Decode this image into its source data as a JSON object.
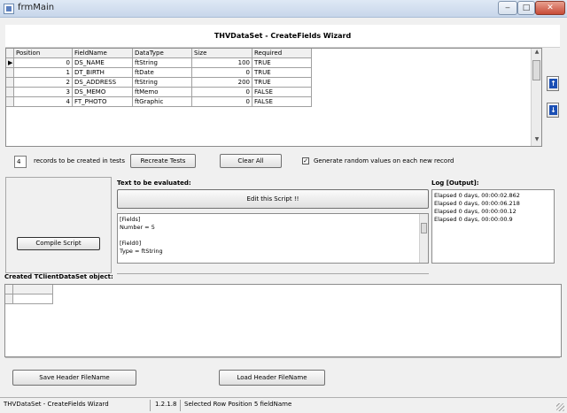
{
  "window": {
    "title": "frmMain",
    "title_ghost": "",
    "controls": {
      "minimize": "‒",
      "maximize": "□",
      "close": "✕"
    }
  },
  "wizard": {
    "title": "THVDataSet - CreateFields Wizard"
  },
  "fields_grid": {
    "columns": [
      "Position",
      "FieldName",
      "DataType",
      "Size",
      "Required"
    ],
    "rows": [
      {
        "position": "0",
        "fieldname": "DS_NAME",
        "datatype": "ftString",
        "size": "100",
        "required": "TRUE",
        "current": true
      },
      {
        "position": "1",
        "fieldname": "DT_BIRTH",
        "datatype": "ftDate",
        "size": "0",
        "required": "TRUE",
        "current": false
      },
      {
        "position": "2",
        "fieldname": "DS_ADDRESS",
        "datatype": "ftString",
        "size": "200",
        "required": "TRUE",
        "current": false
      },
      {
        "position": "3",
        "fieldname": "DS_MEMO",
        "datatype": "ftMemo",
        "size": "0",
        "required": "FALSE",
        "current": false
      },
      {
        "position": "4",
        "fieldname": "FT_PHOTO",
        "datatype": "ftGraphic",
        "size": "0",
        "required": "FALSE",
        "current": false
      }
    ],
    "current_row_marker": "▶"
  },
  "options": {
    "records_value": "4",
    "records_label": "records to be created in tests",
    "recreate_tests_label": "Recreate Tests",
    "clear_all_label": "Clear All",
    "random_checked": true,
    "random_label": "Generate random values on each new record"
  },
  "script": {
    "compile_label": "Compile Script",
    "section_title": "Text to be evaluated:",
    "edit_label": "Edit this Script !!",
    "lines": [
      "[Fields]",
      "Number = 5",
      "",
      "[Field0]",
      "Type = ftString"
    ]
  },
  "log": {
    "title": "Log [Output]:",
    "lines": [
      "Elapsed 0 days, 00:00:02.862",
      "Elapsed 0 days, 00:00:06.218",
      "Elapsed 0 days, 00:00:00.12",
      "Elapsed 0 days, 00:00:00.9"
    ]
  },
  "client_dataset": {
    "title": "Created TClientDataSet object:"
  },
  "bottom": {
    "save_header_label": "Save Header FileName",
    "load_header_label": "Load Header FileName"
  },
  "statusbar": {
    "app_name": "THVDataSet - CreateFields Wizard",
    "version": "1.2.1.8",
    "message": "Selected Row Position 5 fieldName"
  }
}
